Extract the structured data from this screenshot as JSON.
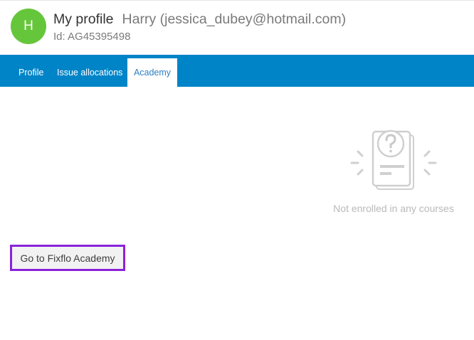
{
  "header": {
    "avatar_initial": "H",
    "page_title": "My profile",
    "user_info": "Harry (jessica_dubey@hotmail.com)",
    "user_id": "Id: AG45395498"
  },
  "tabs": [
    {
      "label": "Profile",
      "active": false
    },
    {
      "label": "Issue allocations",
      "active": false
    },
    {
      "label": "Academy",
      "active": true
    }
  ],
  "main": {
    "empty_icon": "unknown-document-icon",
    "empty_message": "Not enrolled in any courses",
    "academy_button_label": "Go to Fixflo Academy"
  },
  "colors": {
    "avatar": "#66c63b",
    "tab_bar": "#0084c8",
    "active_tab_text": "#2e7fc0",
    "button_highlight": "#8a22d9"
  }
}
